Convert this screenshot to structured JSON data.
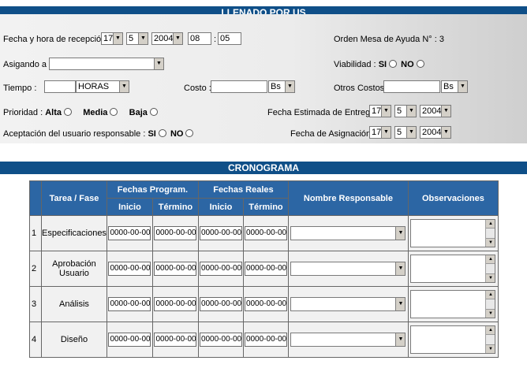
{
  "llenado": {
    "header": "LLENADO POR US",
    "fecha_label": "Fecha y hora de recepción :",
    "fecha_day": "17",
    "fecha_month": "5",
    "fecha_year": "2004",
    "hora_h": "08",
    "hora_sep": ":",
    "hora_m": "05",
    "orden_label": "Orden Mesa de Ayuda N° : 3",
    "asignado_label": "Asigando a :",
    "asignado_value": "",
    "viabilidad_label": "Viabilidad :",
    "si": "SI",
    "no": "NO",
    "tiempo_label": "Tiempo :",
    "tiempo_value": "",
    "tiempo_unit": "HORAS",
    "costo_label": "Costo :",
    "costo_value": "",
    "costo_currency": "Bs",
    "otros_label": "Otros Costos:",
    "otros_value": "",
    "otros_currency": "Bs",
    "prioridad_label": "Prioridad :",
    "alta": "Alta",
    "media": "Media",
    "baja": "Baja",
    "fecha_entrega_label": "Fecha Estimada de Entrega :",
    "entrega_day": "17",
    "entrega_month": "5",
    "entrega_year": "2004",
    "aceptacion_label": "Aceptación del usuario responsable :",
    "fecha_asig_label": "Fecha de Asignación :",
    "asig_day": "17",
    "asig_month": "5",
    "asig_year": "2004"
  },
  "cronograma": {
    "header": "CRONOGRAMA",
    "col_tarea": "Tarea / Fase",
    "col_programadas": "Fechas Program.",
    "col_reales": "Fechas Reales",
    "col_inicio": "Inicio",
    "col_termino": "Término",
    "col_responsable": "Nombre Responsable",
    "col_observaciones": "Observaciones",
    "rows": [
      {
        "num": "1",
        "fase": "Especificaciones",
        "p_inicio": "0000-00-00",
        "p_termino": "0000-00-00",
        "r_inicio": "0000-00-00",
        "r_termino": "0000-00-00",
        "responsable": "",
        "obs": ""
      },
      {
        "num": "2",
        "fase": "Aprobación Usuario",
        "p_inicio": "0000-00-00",
        "p_termino": "0000-00-00",
        "r_inicio": "0000-00-00",
        "r_termino": "0000-00-00",
        "responsable": "",
        "obs": ""
      },
      {
        "num": "3",
        "fase": "Análisis",
        "p_inicio": "0000-00-00",
        "p_termino": "0000-00-00",
        "r_inicio": "0000-00-00",
        "r_termino": "0000-00-00",
        "responsable": "",
        "obs": ""
      },
      {
        "num": "4",
        "fase": "Diseño",
        "p_inicio": "0000-00-00",
        "p_termino": "0000-00-00",
        "r_inicio": "0000-00-00",
        "r_termino": "0000-00-00",
        "responsable": "",
        "obs": ""
      }
    ]
  },
  "colors": {
    "header_bg": "#0f4f88",
    "table_header_bg": "#2c66a4",
    "header_text": "#ffffff"
  },
  "icons": {
    "dropdown": "dropdown-arrow-icon",
    "radio": "radio-button-icon"
  }
}
